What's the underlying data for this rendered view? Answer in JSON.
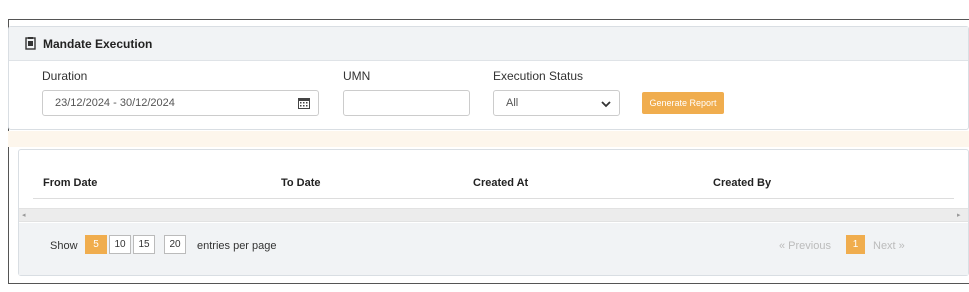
{
  "panel": {
    "title": "Mandate Execution",
    "duration_label": "Duration",
    "duration_value": "23/12/2024 - 30/12/2024",
    "umn_label": "UMN",
    "umn_value": "",
    "status_label": "Execution Status",
    "status_value": "All",
    "generate_label": "Generate Report"
  },
  "table": {
    "columns": [
      "From Date",
      "To Date",
      "Created At",
      "Created By"
    ],
    "rows": []
  },
  "footer": {
    "show_label": "Show",
    "page_sizes": [
      "5",
      "10",
      "15",
      "20"
    ],
    "selected_page_size": "5",
    "entries_label": "entries per page",
    "previous_label": "« Previous",
    "current_page": "1",
    "next_label": "Next »"
  },
  "colors": {
    "accent": "#f0ad4e",
    "header_bg": "#f1f3f5"
  }
}
